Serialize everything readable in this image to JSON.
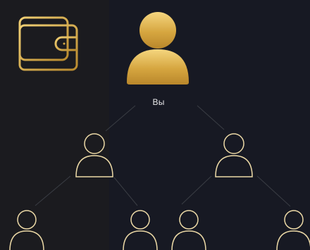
{
  "referral_tree": {
    "root_label": "Вы"
  },
  "icons": {
    "wallet": "wallet-icon",
    "user_filled": "user-icon",
    "user_outline": "user-outline-icon"
  },
  "colors": {
    "gold_light": "#f3d27e",
    "gold_dark": "#a77a24",
    "outline_gold": "#ecd9a6",
    "connector": "#3a3d44",
    "background": "#171820"
  }
}
